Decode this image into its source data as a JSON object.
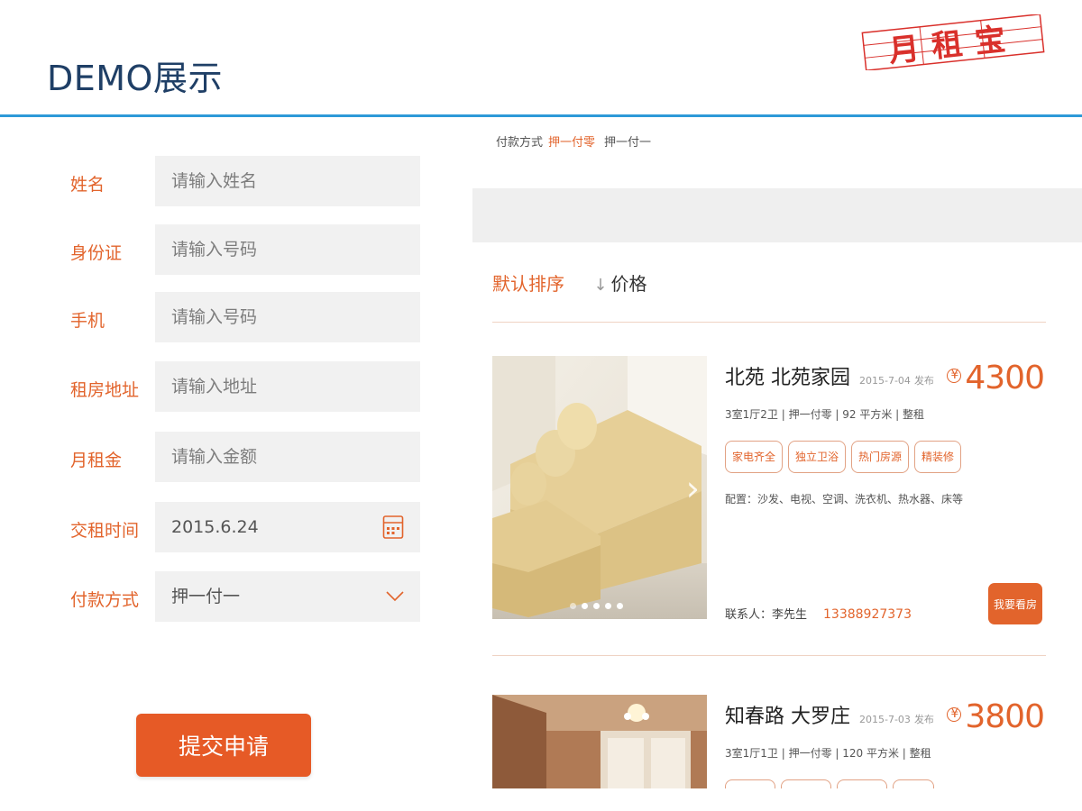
{
  "slide": {
    "title": "DEMO展示"
  },
  "logo": {
    "text": "月租宝"
  },
  "form": {
    "fields": [
      {
        "label": "姓名",
        "placeholder": "请输入姓名"
      },
      {
        "label": "身份证",
        "placeholder": "请输入号码"
      },
      {
        "label": "手机",
        "placeholder": "请输入号码"
      },
      {
        "label": "租房地址",
        "placeholder": "请输入地址"
      },
      {
        "label": "月租金",
        "placeholder": "请输入金额"
      },
      {
        "label": "交租时间",
        "value": "2015.6.24"
      },
      {
        "label": "付款方式",
        "value": "押一付一"
      }
    ],
    "submit_label": "提交申请"
  },
  "app": {
    "top_strip": {
      "left": "付款方式",
      "highlight": "押一付零",
      "right": "押一付一"
    },
    "sort": {
      "default_label": "默认排序",
      "price_label": "价格"
    },
    "listings": [
      {
        "title": "北苑 北苑家园",
        "date": "2015-7-04",
        "publish_label": "发布",
        "price": "4300",
        "specs": "3室1厅2卫 | 押一付零 | 92 平方米 | 整租",
        "tags": [
          "家电齐全",
          "独立卫浴",
          "热门房源",
          "精装修"
        ],
        "amenities": "配置：沙发、电视、空调、洗衣机、热水器、床等",
        "contact_label": "联系人：李先生",
        "phone": "13388927373",
        "button_label": "我要看房"
      },
      {
        "title": "知春路 大罗庄",
        "date": "2015-7-03",
        "publish_label": "发布",
        "price": "3800",
        "specs": "3室1厅1卫 | 押一付零 | 120 平方米 | 整租"
      }
    ]
  },
  "colors": {
    "accent": "#e2642c",
    "rule": "#2d9ad8",
    "title": "#1f3f66"
  }
}
